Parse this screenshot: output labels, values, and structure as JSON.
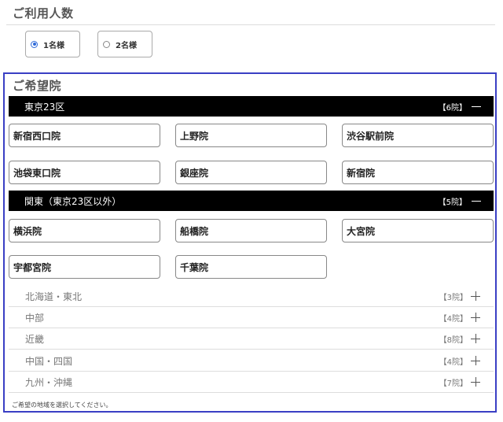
{
  "usage": {
    "heading": "ご利用人数",
    "options": [
      {
        "label": "1名様",
        "selected": true
      },
      {
        "label": "2名様",
        "selected": false
      }
    ]
  },
  "clinic": {
    "heading": "ご希望院",
    "accent_color": "#3a3fc4",
    "regions_expanded": [
      {
        "name": "東京23区",
        "count": "【6院】",
        "toggle": "minus-icon",
        "clinics": [
          "新宿西口院",
          "上野院",
          "渋谷駅前院",
          "池袋東口院",
          "銀座院",
          "新宿院"
        ]
      },
      {
        "name": "関東（東京23区以外）",
        "count": "【5院】",
        "toggle": "minus-icon",
        "clinics": [
          "横浜院",
          "船橋院",
          "大宮院",
          "宇都宮院",
          "千葉院"
        ]
      }
    ],
    "regions_collapsed": [
      {
        "name": "北海道・東北",
        "count": "【3院】",
        "toggle": "plus-icon"
      },
      {
        "name": "中部",
        "count": "【4院】",
        "toggle": "plus-icon"
      },
      {
        "name": "近畿",
        "count": "【8院】",
        "toggle": "plus-icon"
      },
      {
        "name": "中国・四国",
        "count": "【4院】",
        "toggle": "plus-icon"
      },
      {
        "name": "九州・沖縄",
        "count": "【7院】",
        "toggle": "plus-icon"
      }
    ],
    "hint": "ご希望の地域を選択してください。"
  }
}
